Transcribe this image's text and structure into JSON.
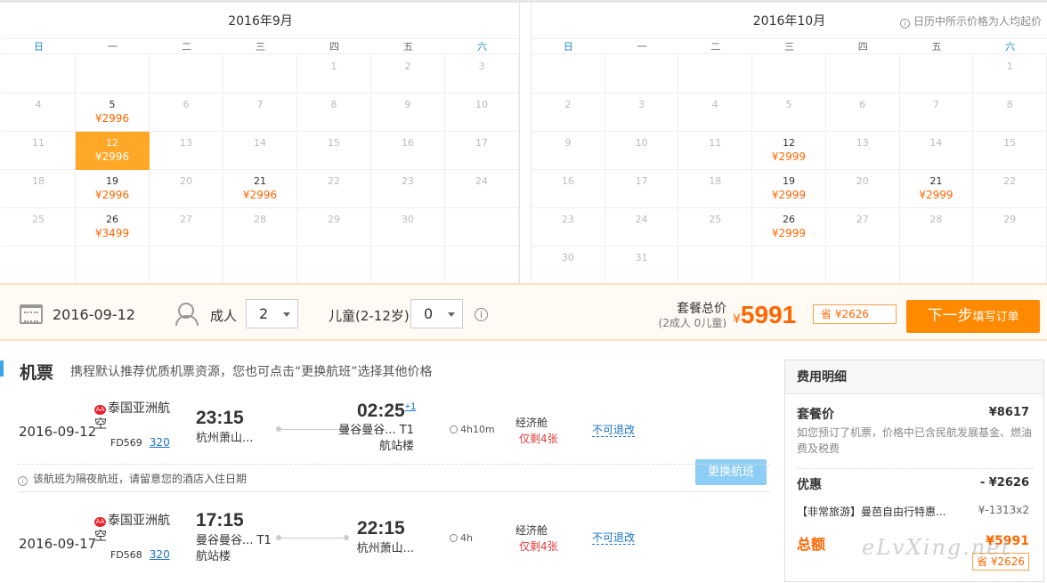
{
  "calendar": {
    "tip": "日历中所示价格为人均起价",
    "weekdays": [
      "日",
      "一",
      "二",
      "三",
      "四",
      "五",
      "六"
    ],
    "months": [
      {
        "title": "2016年9月",
        "cells": [
          {
            "d": "",
            "p": ""
          },
          {
            "d": "",
            "p": ""
          },
          {
            "d": "",
            "p": ""
          },
          {
            "d": "",
            "p": ""
          },
          {
            "d": "1",
            "p": ""
          },
          {
            "d": "2",
            "p": ""
          },
          {
            "d": "3",
            "p": ""
          },
          {
            "d": "4",
            "p": ""
          },
          {
            "d": "5",
            "p": "¥2996"
          },
          {
            "d": "6",
            "p": ""
          },
          {
            "d": "7",
            "p": ""
          },
          {
            "d": "8",
            "p": ""
          },
          {
            "d": "9",
            "p": ""
          },
          {
            "d": "10",
            "p": ""
          },
          {
            "d": "11",
            "p": ""
          },
          {
            "d": "12",
            "p": "¥2996",
            "sel": true
          },
          {
            "d": "13",
            "p": ""
          },
          {
            "d": "14",
            "p": ""
          },
          {
            "d": "15",
            "p": ""
          },
          {
            "d": "16",
            "p": ""
          },
          {
            "d": "17",
            "p": ""
          },
          {
            "d": "18",
            "p": ""
          },
          {
            "d": "19",
            "p": "¥2996"
          },
          {
            "d": "20",
            "p": ""
          },
          {
            "d": "21",
            "p": "¥2996"
          },
          {
            "d": "22",
            "p": ""
          },
          {
            "d": "23",
            "p": ""
          },
          {
            "d": "24",
            "p": ""
          },
          {
            "d": "25",
            "p": ""
          },
          {
            "d": "26",
            "p": "¥3499"
          },
          {
            "d": "27",
            "p": ""
          },
          {
            "d": "28",
            "p": ""
          },
          {
            "d": "29",
            "p": ""
          },
          {
            "d": "30",
            "p": ""
          },
          {
            "d": "",
            "p": ""
          },
          {
            "d": "",
            "p": ""
          },
          {
            "d": "",
            "p": ""
          },
          {
            "d": "",
            "p": ""
          },
          {
            "d": "",
            "p": ""
          },
          {
            "d": "",
            "p": ""
          },
          {
            "d": "",
            "p": ""
          },
          {
            "d": "",
            "p": ""
          }
        ]
      },
      {
        "title": "2016年10月",
        "cells": [
          {
            "d": "",
            "p": ""
          },
          {
            "d": "",
            "p": ""
          },
          {
            "d": "",
            "p": ""
          },
          {
            "d": "",
            "p": ""
          },
          {
            "d": "",
            "p": ""
          },
          {
            "d": "",
            "p": ""
          },
          {
            "d": "1",
            "p": ""
          },
          {
            "d": "2",
            "p": ""
          },
          {
            "d": "3",
            "p": ""
          },
          {
            "d": "4",
            "p": ""
          },
          {
            "d": "5",
            "p": ""
          },
          {
            "d": "6",
            "p": ""
          },
          {
            "d": "7",
            "p": ""
          },
          {
            "d": "8",
            "p": ""
          },
          {
            "d": "9",
            "p": ""
          },
          {
            "d": "10",
            "p": ""
          },
          {
            "d": "11",
            "p": ""
          },
          {
            "d": "12",
            "p": "¥2999"
          },
          {
            "d": "13",
            "p": ""
          },
          {
            "d": "14",
            "p": ""
          },
          {
            "d": "15",
            "p": ""
          },
          {
            "d": "16",
            "p": ""
          },
          {
            "d": "17",
            "p": ""
          },
          {
            "d": "18",
            "p": ""
          },
          {
            "d": "19",
            "p": "¥2999"
          },
          {
            "d": "20",
            "p": ""
          },
          {
            "d": "21",
            "p": "¥2999"
          },
          {
            "d": "22",
            "p": ""
          },
          {
            "d": "23",
            "p": ""
          },
          {
            "d": "24",
            "p": ""
          },
          {
            "d": "25",
            "p": ""
          },
          {
            "d": "26",
            "p": "¥2999"
          },
          {
            "d": "27",
            "p": ""
          },
          {
            "d": "28",
            "p": ""
          },
          {
            "d": "29",
            "p": ""
          },
          {
            "d": "30",
            "p": ""
          },
          {
            "d": "31",
            "p": ""
          },
          {
            "d": "",
            "p": ""
          },
          {
            "d": "",
            "p": ""
          },
          {
            "d": "",
            "p": ""
          },
          {
            "d": "",
            "p": ""
          },
          {
            "d": "",
            "p": ""
          }
        ]
      }
    ]
  },
  "booking": {
    "date": "2016-09-12",
    "adult_label": "成人",
    "adult_value": "2",
    "child_label": "儿童(2-12岁)",
    "child_value": "0",
    "total_label": "套餐总价",
    "total_sub": "(2成人 0儿童)",
    "currency": "¥",
    "total_price": "5991",
    "save_tag": "省 ¥2626",
    "next_label": "下一步",
    "next_sub": "填写订单"
  },
  "flights": {
    "title": "机票",
    "desc": "携程默认推荐优质机票资源，您也可点击“更换航班”选择其他价格",
    "logo_text": "AA",
    "change_label": "更换航班",
    "note": "该航班为隔夜航班，请留意您的酒店入住日期",
    "items": [
      {
        "date": "2016-09-12",
        "airline": "泰国亚洲航空",
        "flight_no": "FD569",
        "plane": "320",
        "dep_time": "23:15",
        "dep_place": "杭州萧山...",
        "arr_time": "02:25",
        "arr_plus": "+1",
        "arr_place": "曼谷曼谷... T1",
        "arr_place2": "航站楼",
        "duration": "4h10m",
        "cabin": "经济舱",
        "left": "仅剩4张",
        "refund": "不可退改"
      },
      {
        "date": "2016-09-17",
        "airline": "泰国亚洲航空",
        "flight_no": "FD568",
        "plane": "320",
        "dep_time": "17:15",
        "dep_place": "曼谷曼谷... T1",
        "dep_place2": "航站楼",
        "arr_time": "22:15",
        "arr_place": "杭州萧山...",
        "duration": "4h",
        "cabin": "经济舱",
        "left": "仅剩4张",
        "refund": "不可退改"
      }
    ]
  },
  "fee": {
    "title": "费用明细",
    "package_label": "套餐价",
    "package_value": "¥8617",
    "package_desc": "如您预订了机票，价格中已含民航发展基金、燃油费及税费",
    "discount_label": "优惠",
    "discount_value": "- ¥2626",
    "promo_label": "【非常旅游】曼芭自由行特惠...",
    "promo_value": "¥-1313x2",
    "total_label": "总额",
    "total_value": "¥5991",
    "total_save": "省 ¥2626"
  },
  "watermark": "eLvXing.net"
}
